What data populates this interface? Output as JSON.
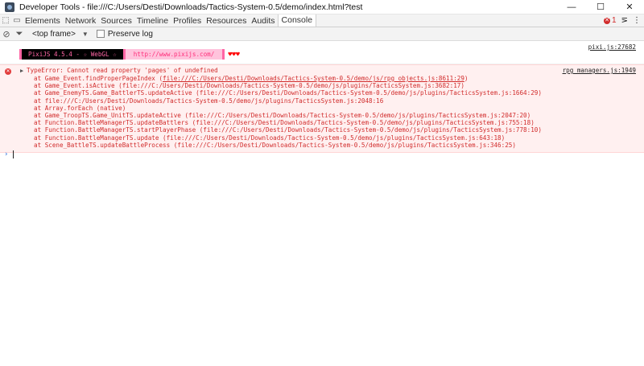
{
  "window": {
    "title": "Developer Tools - file:///C:/Users/Desti/Downloads/Tactics-System-0.5/demo/index.html?test",
    "controls": {
      "minimize": "—",
      "maximize": "☐",
      "close": "✕"
    }
  },
  "tabs": {
    "items": [
      "Elements",
      "Network",
      "Sources",
      "Timeline",
      "Profiles",
      "Resources",
      "Audits",
      "Console"
    ],
    "active": "Console",
    "error_count": "1"
  },
  "toolbar": {
    "frame": "<top frame>",
    "preserve_log": "Preserve log"
  },
  "console": {
    "pixi": {
      "source": "pixi.js:27682",
      "banner_main": "PixiJS 4.5.4 - ☆ WebGL ☆",
      "banner_url": "http://www.pixijs.com/",
      "hearts": "♥♥♥"
    },
    "error": {
      "source": "rpg_managers.js:1949",
      "message": "TypeError: Cannot read property 'pages' of undefined",
      "trace": [
        {
          "text": "at Game_Event.findProperPageIndex (",
          "link": "file:///C:/Users/Desti/Downloads/Tactics-System-0.5/demo/js/rpg_objects.js:8611:29",
          "end": ")"
        },
        {
          "text": "at Game_Event.isActive (file:///C:/Users/Desti/Downloads/Tactics-System-0.5/demo/js/plugins/TacticsSystem.js:3682:17)",
          "link": "",
          "end": ""
        },
        {
          "text": "at Game_EnemyTS.Game_BattlerTS.updateActive (file:///C:/Users/Desti/Downloads/Tactics-System-0.5/demo/js/plugins/TacticsSystem.js:1664:29)",
          "link": "",
          "end": ""
        },
        {
          "text": "at file:///C:/Users/Desti/Downloads/Tactics-System-0.5/demo/js/plugins/TacticsSystem.js:2048:16",
          "link": "",
          "end": ""
        },
        {
          "text": "at Array.forEach (native)",
          "link": "",
          "end": ""
        },
        {
          "text": "at Game_TroopTS.Game_UnitTS.updateActive (file:///C:/Users/Desti/Downloads/Tactics-System-0.5/demo/js/plugins/TacticsSystem.js:2047:20)",
          "link": "",
          "end": ""
        },
        {
          "text": "at Function.BattleManagerTS.updateBattlers (file:///C:/Users/Desti/Downloads/Tactics-System-0.5/demo/js/plugins/TacticsSystem.js:755:18)",
          "link": "",
          "end": ""
        },
        {
          "text": "at Function.BattleManagerTS.startPlayerPhase (file:///C:/Users/Desti/Downloads/Tactics-System-0.5/demo/js/plugins/TacticsSystem.js:778:10)",
          "link": "",
          "end": ""
        },
        {
          "text": "at Function.BattleManagerTS.update (file:///C:/Users/Desti/Downloads/Tactics-System-0.5/demo/js/plugins/TacticsSystem.js:643:18)",
          "link": "",
          "end": ""
        },
        {
          "text": "at Scene_BattleTS.updateBattleProcess (file:///C:/Users/Desti/Downloads/Tactics-System-0.5/demo/js/plugins/TacticsSystem.js:346:25)",
          "link": "",
          "end": ""
        }
      ]
    },
    "prompt": "›"
  }
}
